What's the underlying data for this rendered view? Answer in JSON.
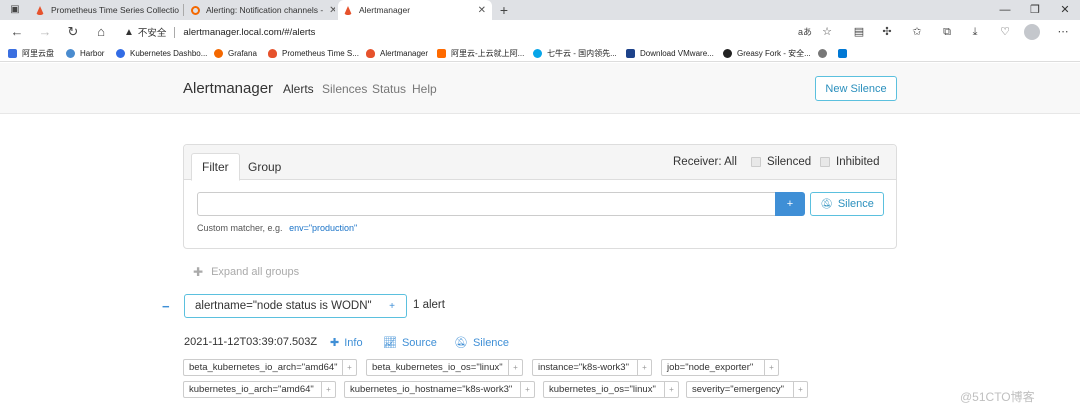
{
  "browser": {
    "tabs": [
      {
        "title": "Prometheus Time Series Collectio",
        "active": false
      },
      {
        "title": "Alerting: Notification channels -",
        "active": false
      },
      {
        "title": "Alertmanager",
        "active": true
      }
    ],
    "new_tab": "+",
    "address": {
      "insecure_label": "不安全",
      "url": "alertmanager.local.com/#/alerts"
    },
    "bookmarks": [
      "阿里云盘",
      "Harbor",
      "Kubernetes Dashbo...",
      "Grafana",
      "Prometheus Time S...",
      "Alertmanager",
      "阿里云-上云就上阿...",
      "七牛云 - 国内领先...",
      "Download VMware...",
      "Greasy Fork - 安全..."
    ],
    "colors": {
      "tab_strip": "#dfe1e5",
      "prometheus_icon": "#e6522c",
      "grafana_icon": "#f46800"
    }
  },
  "alertmanager": {
    "brand": "Alertmanager",
    "nav": [
      "Alerts",
      "Silences",
      "Status",
      "Help"
    ],
    "new_silence": "New Silence",
    "filter_tabs": [
      "Filter",
      "Group"
    ],
    "receiver": "Receiver: All",
    "silenced": "Silenced",
    "inhibited": "Inhibited",
    "filter_value": "",
    "plus": "+",
    "silence_button": "Silence",
    "hint_text": "Custom matcher, e.g.",
    "hint_example": "env=\"production\"",
    "expand_all": "Expand all groups",
    "group": {
      "collapse": "−",
      "label": "alertname=\"node status is WODN\"",
      "plus": "+",
      "count": "1 alert"
    },
    "alert": {
      "timestamp": "2021-11-12T03:39:07.503Z",
      "actions": [
        "Info",
        "Source",
        "Silence"
      ],
      "labels_row1": [
        "beta_kubernetes_io_arch=\"amd64\"",
        "beta_kubernetes_io_os=\"linux\"",
        "instance=\"k8s-work3\"",
        "job=\"node_exporter\""
      ],
      "labels_row2": [
        "kubernetes_io_arch=\"amd64\"",
        "kubernetes_io_hostname=\"k8s-work3\"",
        "kubernetes_io_os=\"linux\"",
        "severity=\"emergency\""
      ],
      "label_plus": "+"
    },
    "colors": {
      "accent": "#3f8fd6",
      "info_border": "#5bc0de",
      "link": "#2a8fbd"
    }
  },
  "watermark": "@51CTO博客"
}
